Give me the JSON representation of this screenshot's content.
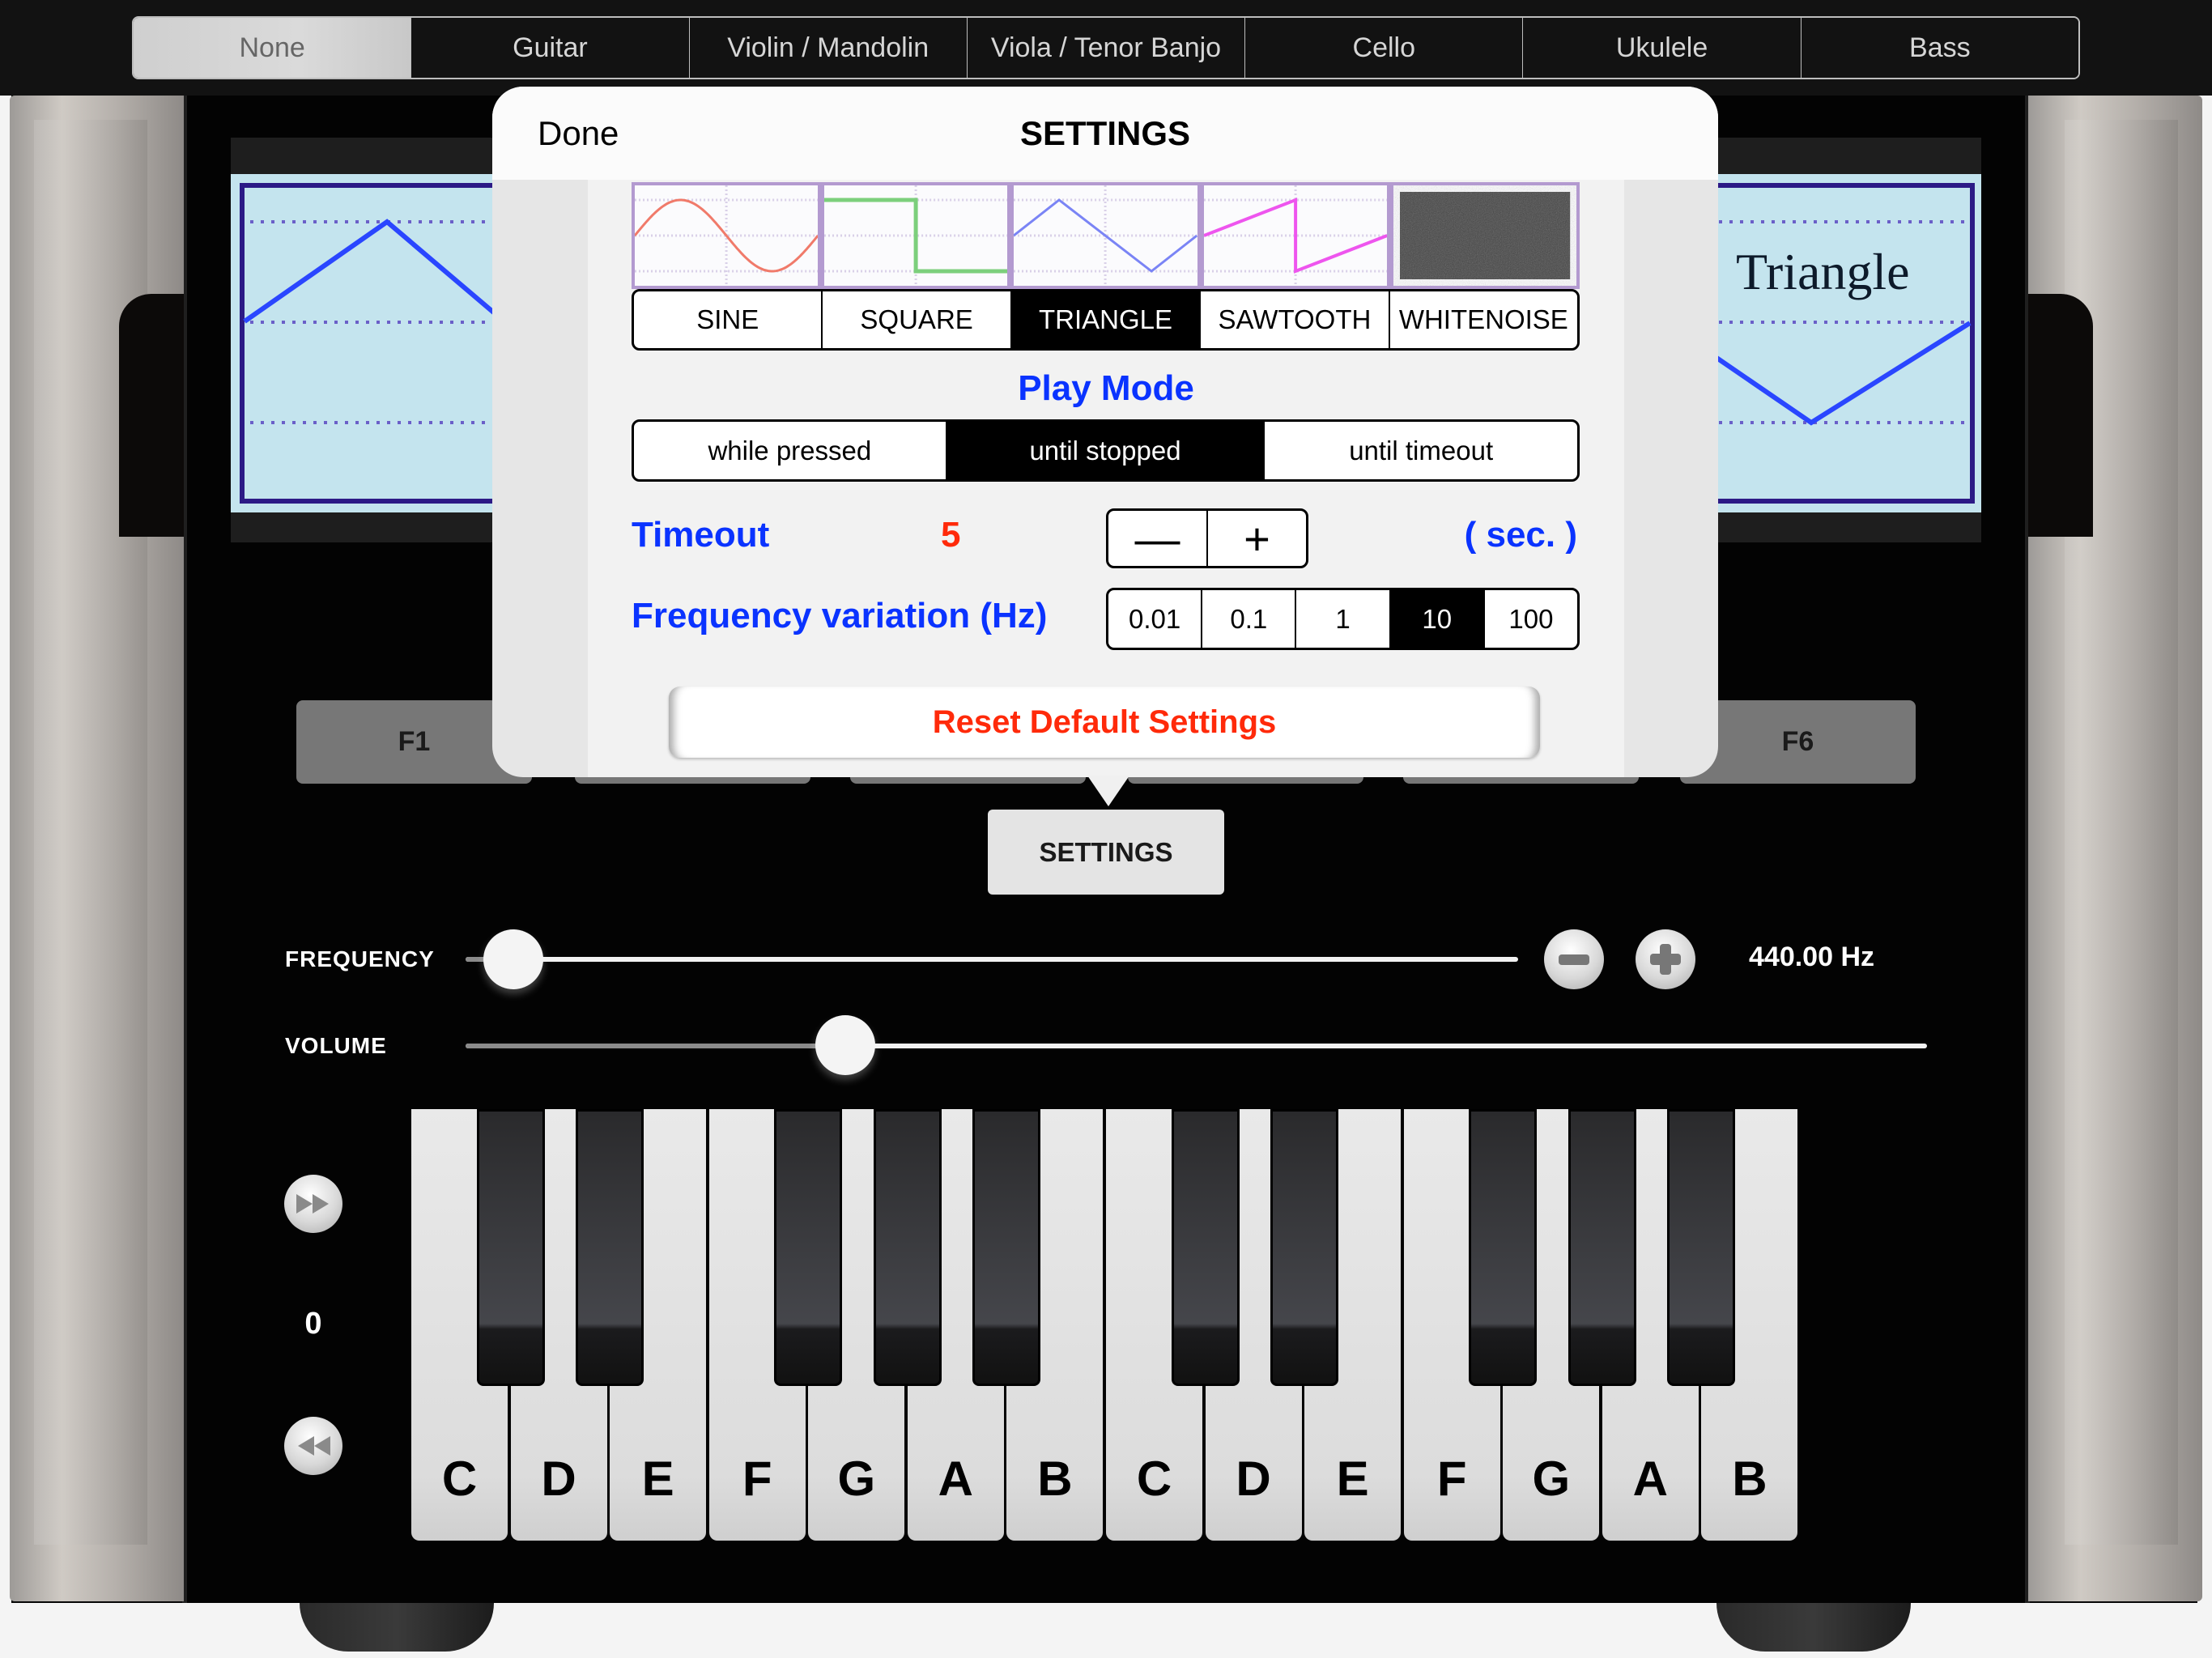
{
  "instrument_bar": {
    "options": [
      "None",
      "Guitar",
      "Violin / Mandolin",
      "Viola / Tenor Banjo",
      "Cello",
      "Ukulele",
      "Bass"
    ],
    "selected": "None"
  },
  "display": {
    "waveform_name": "Triangle",
    "line_color": "#2a46ff",
    "frame_color": "#2c1a86"
  },
  "function_buttons": [
    "F1",
    "F6"
  ],
  "settings_button": {
    "label": "SETTINGS"
  },
  "frequency": {
    "label": "FREQUENCY",
    "value_text": "440.00 Hz",
    "slider_fraction": 0.045,
    "decrement_icon": "minus-icon",
    "increment_icon": "plus-icon"
  },
  "volume": {
    "label": "VOLUME",
    "slider_fraction": 0.26
  },
  "octave": {
    "value": "0",
    "up_icon": "fast-forward-icon",
    "down_icon": "rewind-icon"
  },
  "keyboard": {
    "white_keys": [
      "C",
      "D",
      "E",
      "F",
      "G",
      "A",
      "B",
      "C",
      "D",
      "E",
      "F",
      "G",
      "A",
      "B"
    ]
  },
  "settings_popover": {
    "done_label": "Done",
    "title": "SETTINGS",
    "waveforms": {
      "thumbnails": [
        {
          "name": "sine",
          "color": "#f07a6a"
        },
        {
          "name": "square",
          "color": "#7ccf7c"
        },
        {
          "name": "triangle",
          "color": "#7a84f5"
        },
        {
          "name": "sawtooth",
          "color": "#ee55ee"
        },
        {
          "name": "whitenoise",
          "color": "#444444"
        }
      ],
      "options": [
        "SINE",
        "SQUARE",
        "TRIANGLE",
        "SAWTOOTH",
        "WHITENOISE"
      ],
      "selected": "TRIANGLE"
    },
    "play_mode": {
      "label": "Play Mode",
      "options": [
        "while pressed",
        "until stopped",
        "until timeout"
      ],
      "selected": "until stopped"
    },
    "timeout": {
      "label": "Timeout",
      "value": "5",
      "decrement": "—",
      "increment": "+",
      "unit": "( sec. )"
    },
    "frequency_variation": {
      "label": "Frequency variation (Hz)",
      "options": [
        "0.01",
        "0.1",
        "1",
        "10",
        "100"
      ],
      "selected": "10"
    },
    "reset_label": "Reset Default Settings",
    "accent_blue": "#0a33ff",
    "accent_red": "#ff2a0a"
  }
}
